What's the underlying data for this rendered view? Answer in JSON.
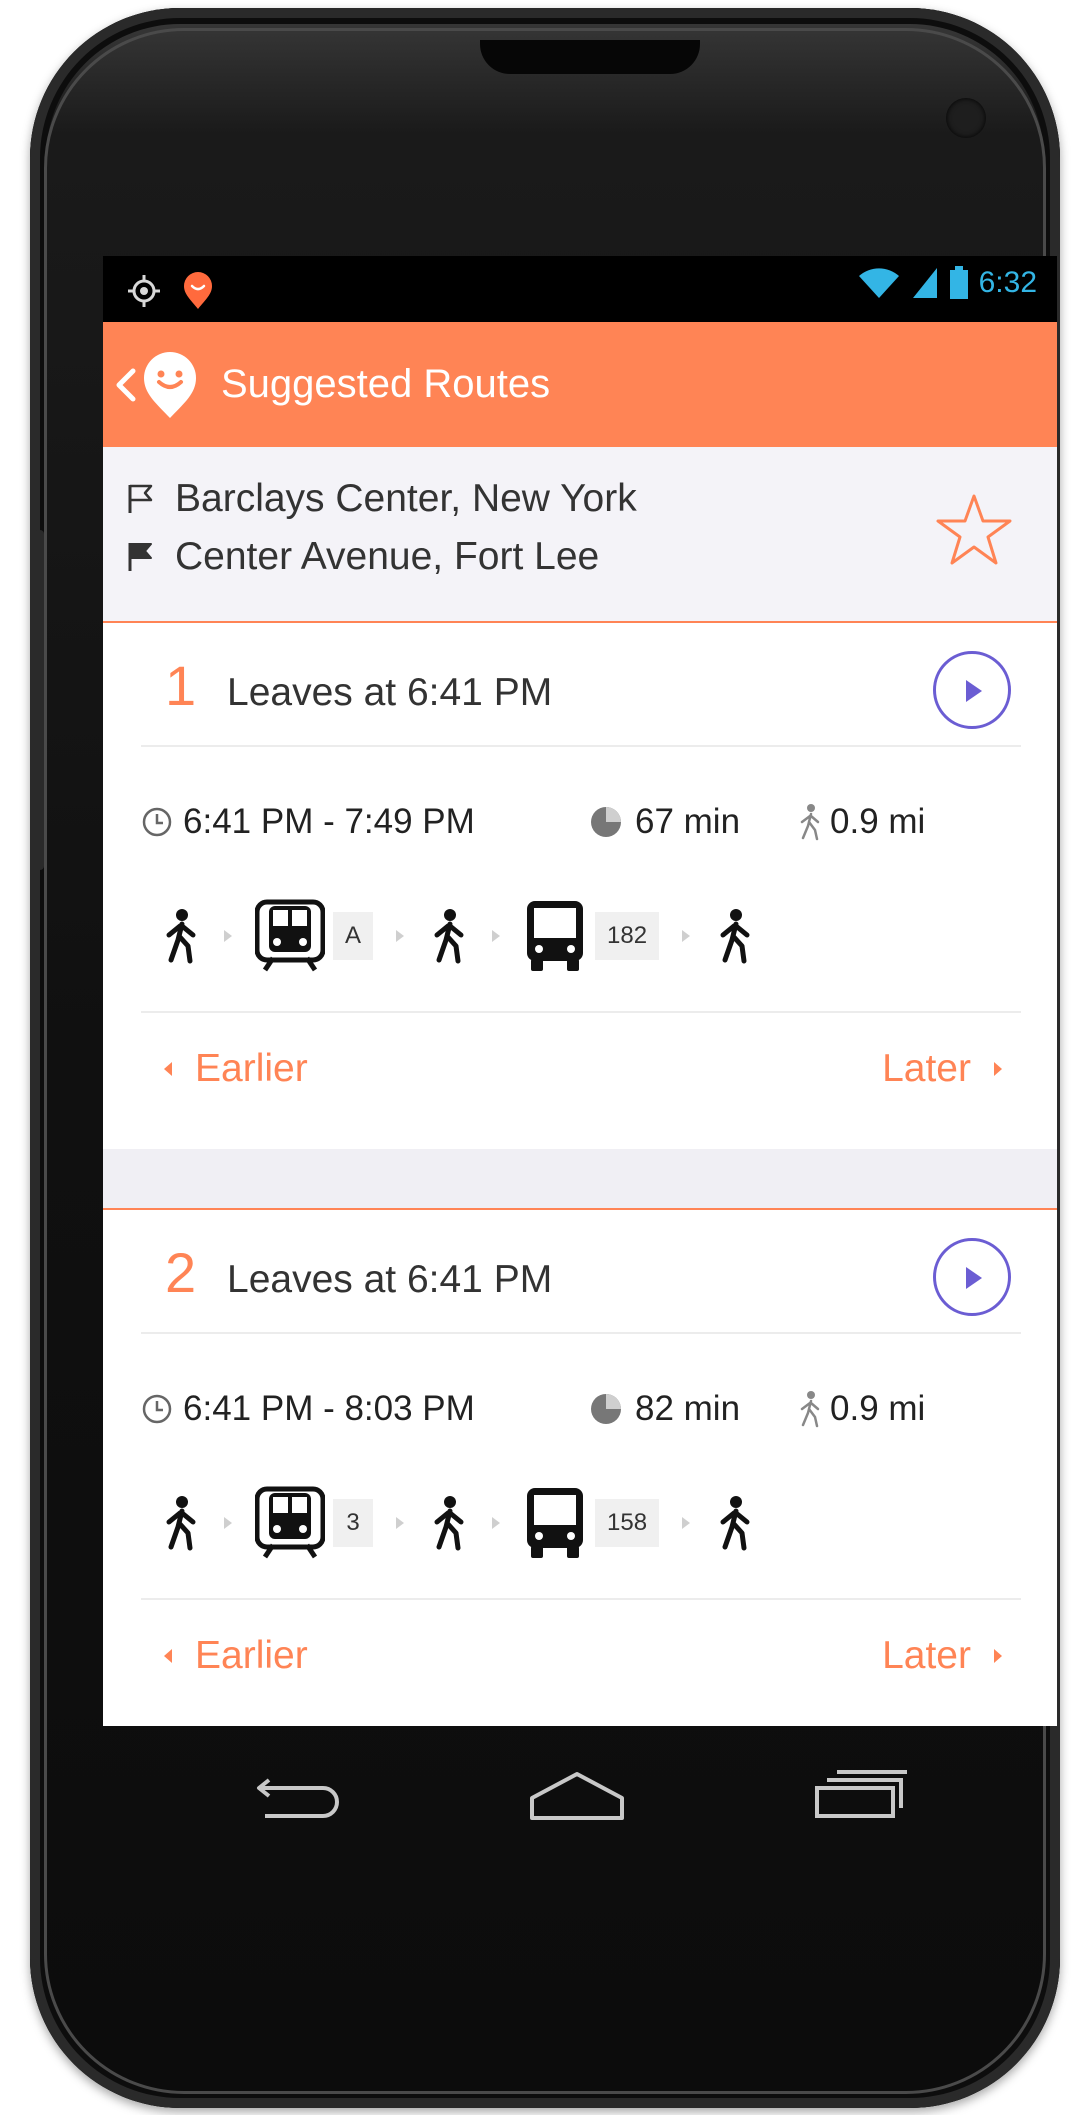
{
  "status_bar": {
    "time": "6:32",
    "icons": [
      "location-icon",
      "app-notification-icon",
      "wifi-icon",
      "signal-icon",
      "battery-icon"
    ]
  },
  "app_bar": {
    "title": "Suggested Routes",
    "icons": [
      "back-icon",
      "app-logo-icon"
    ]
  },
  "trip": {
    "from": "Barclays Center, New York",
    "to": "Center Avenue, Fort Lee",
    "favorite_icon": "star-outline-icon"
  },
  "routes": [
    {
      "number": "1",
      "leaves": "Leaves at 6:41 PM",
      "time_range": "6:41 PM - 7:49 PM",
      "duration": "67 min",
      "walk_distance": "0.9 mi",
      "legs": [
        {
          "mode": "walk"
        },
        {
          "mode": "train",
          "line": "A"
        },
        {
          "mode": "walk"
        },
        {
          "mode": "bus",
          "line": "182"
        },
        {
          "mode": "walk"
        }
      ],
      "earlier_label": "Earlier",
      "later_label": "Later"
    },
    {
      "number": "2",
      "leaves": "Leaves at 6:41 PM",
      "time_range": "6:41 PM - 8:03 PM",
      "duration": "82 min",
      "walk_distance": "0.9 mi",
      "legs": [
        {
          "mode": "walk"
        },
        {
          "mode": "train",
          "line": "3"
        },
        {
          "mode": "walk"
        },
        {
          "mode": "bus",
          "line": "158"
        },
        {
          "mode": "walk"
        }
      ],
      "earlier_label": "Earlier",
      "later_label": "Later"
    }
  ],
  "colors": {
    "accent": "#ff8455",
    "go_button": "#6b5dd3",
    "status_icons": "#33b5e5",
    "header_bg": "#f4f3f8"
  },
  "nav_keys": [
    "back-key-icon",
    "home-key-icon",
    "recents-key-icon"
  ]
}
